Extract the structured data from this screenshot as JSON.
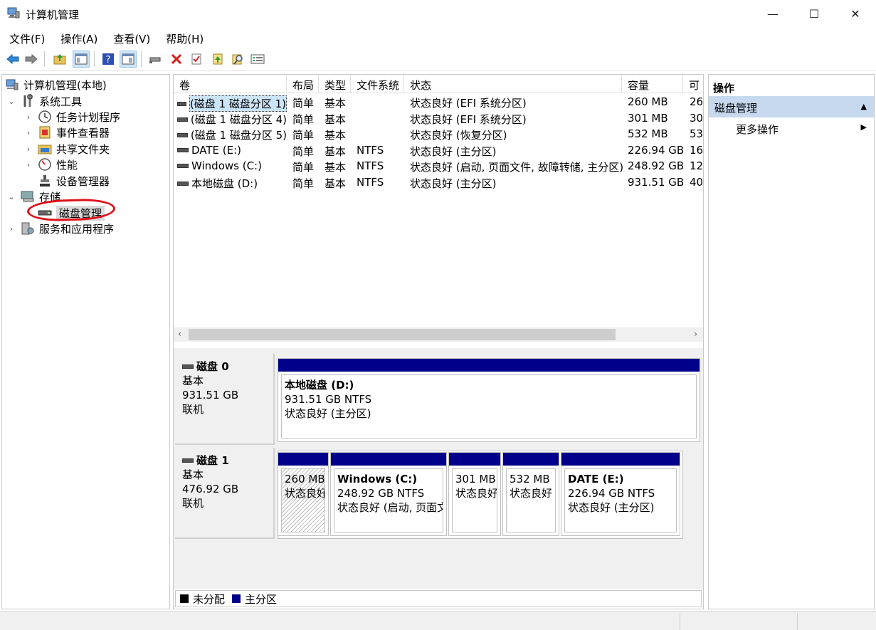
{
  "window": {
    "title": "计算机管理",
    "minimize_glyph": "—",
    "maximize_glyph": "☐",
    "close_glyph": "✕"
  },
  "menu": [
    "文件(F)",
    "操作(A)",
    "查看(V)",
    "帮助(H)"
  ],
  "toolbar": {
    "buttons": [
      "back-arrow-icon",
      "forward-arrow-icon",
      "up-folder-icon",
      "show-hide-tree-icon",
      "help-icon",
      "console-view-icon",
      "connect-icon",
      "delete-icon",
      "checklist-icon",
      "folder-up-icon",
      "search-folder-icon",
      "properties-icon"
    ]
  },
  "tree": {
    "root": "计算机管理(本地)",
    "system_tools": "系统工具",
    "task_scheduler": "任务计划程序",
    "event_viewer": "事件查看器",
    "shared_folders": "共享文件夹",
    "performance": "性能",
    "device_manager": "设备管理器",
    "storage": "存储",
    "disk_management": "磁盘管理",
    "services_apps": "服务和应用程序",
    "collapse_glyph": "⌄",
    "expand_glyph": "›"
  },
  "table": {
    "columns": [
      "卷",
      "布局",
      "类型",
      "文件系统",
      "状态",
      "容量",
      "可"
    ],
    "rows": [
      [
        "(磁盘 1 磁盘分区 1)",
        "简单",
        "基本",
        "",
        "状态良好 (EFI 系统分区)",
        "260 MB",
        "26"
      ],
      [
        "(磁盘 1 磁盘分区 4)",
        "简单",
        "基本",
        "",
        "状态良好 (EFI 系统分区)",
        "301 MB",
        "30"
      ],
      [
        "(磁盘 1 磁盘分区 5)",
        "简单",
        "基本",
        "",
        "状态良好 (恢复分区)",
        "532 MB",
        "53"
      ],
      [
        "DATE (E:)",
        "简单",
        "基本",
        "NTFS",
        "状态良好 (主分区)",
        "226.94 GB",
        "16"
      ],
      [
        "Windows (C:)",
        "简单",
        "基本",
        "NTFS",
        "状态良好 (启动, 页面文件, 故障转储, 主分区)",
        "248.92 GB",
        "12"
      ],
      [
        "本地磁盘 (D:)",
        "简单",
        "基本",
        "NTFS",
        "状态良好 (主分区)",
        "931.51 GB",
        "40"
      ]
    ],
    "scroll_left": "‹",
    "scroll_right": "›"
  },
  "disks": [
    {
      "name": "磁盘 0",
      "type": "基本",
      "size": "931.51 GB",
      "status": "联机",
      "partitions": [
        {
          "name": "本地磁盘 (D:)",
          "size": "931.51 GB NTFS",
          "status": "状态良好 (主分区)"
        }
      ]
    },
    {
      "name": "磁盘 1",
      "type": "基本",
      "size": "476.92 GB",
      "status": "联机",
      "partitions": [
        {
          "name": "",
          "size": "260 MB",
          "status": "状态良好"
        },
        {
          "name": "Windows (C:)",
          "size": "248.92 GB NTFS",
          "status": "状态良好 (启动, 页面文"
        },
        {
          "name": "",
          "size": "301 MB",
          "status": "状态良好"
        },
        {
          "name": "",
          "size": "532 MB",
          "status": "状态良好"
        },
        {
          "name": "DATE (E:)",
          "size": "226.94 GB NTFS",
          "status": "状态良好 (主分区)"
        }
      ]
    }
  ],
  "legend": [
    {
      "label": "未分配",
      "color": "#000000"
    },
    {
      "label": "主分区",
      "color": "#00008b"
    }
  ],
  "actions": {
    "header": "操作",
    "group": "磁盘管理",
    "group_glyph": "▲",
    "more": "更多操作",
    "more_glyph": "▶"
  },
  "colors": {
    "primary_partition": "#00008b",
    "selection": "#cce4f7",
    "action_group_bg": "#c6d9ee",
    "annotation": "#e0101a"
  }
}
